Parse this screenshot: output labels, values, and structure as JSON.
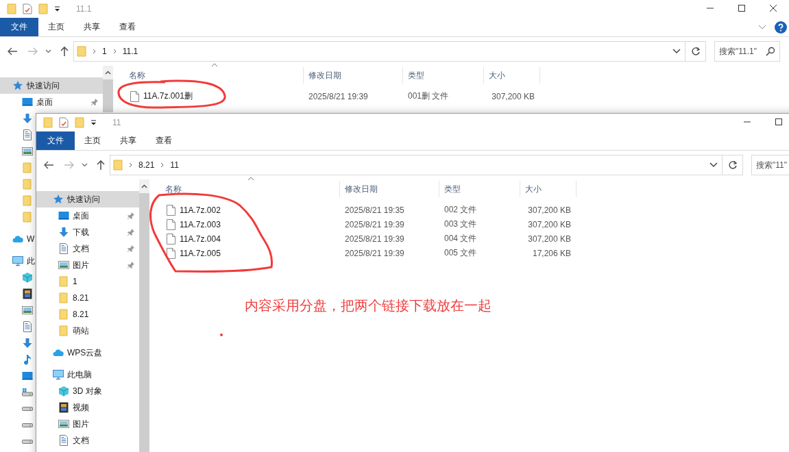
{
  "windows": [
    {
      "title": "11.1",
      "ribbon_tabs": [
        {
          "label": "文件",
          "selected": true
        },
        {
          "label": "主页",
          "selected": false
        },
        {
          "label": "共享",
          "selected": false
        },
        {
          "label": "查看",
          "selected": false
        }
      ],
      "path": [
        "1",
        "11.1"
      ],
      "search": {
        "placeholder": "搜索\"11.1\""
      },
      "columns": [
        "名称",
        "修改日期",
        "类型",
        "大小"
      ],
      "sidebar": [
        {
          "label": "快速访问",
          "kind": "star",
          "selected": true,
          "children": [
            {
              "label": "桌面",
              "kind": "desktop",
              "pinned": true
            },
            {
              "kind": "download",
              "pinned": false
            },
            {
              "kind": "document",
              "pinned": false
            },
            {
              "kind": "picture",
              "pinned": false
            },
            {
              "kind": "folder",
              "pinned": false
            },
            {
              "kind": "folder",
              "pinned": false
            },
            {
              "kind": "folder",
              "pinned": false
            },
            {
              "kind": "folder",
              "pinned": false
            }
          ]
        },
        {
          "label": "W",
          "kind": "cloud",
          "selected": false
        },
        {
          "label": "此",
          "kind": "pc",
          "selected": false,
          "children": [
            {
              "kind": "cube"
            },
            {
              "kind": "video"
            },
            {
              "kind": "picture"
            },
            {
              "kind": "document"
            },
            {
              "kind": "download"
            },
            {
              "kind": "music"
            },
            {
              "kind": "desktop"
            },
            {
              "kind": "drive-win"
            },
            {
              "kind": "drive"
            },
            {
              "kind": "drive"
            },
            {
              "kind": "drive"
            }
          ]
        }
      ],
      "files": [
        {
          "name": "11A.7z.001删",
          "date": "2025/8/21 19:39",
          "type": "001删 文件",
          "size": "307,200 KB"
        }
      ]
    },
    {
      "title": "11",
      "ribbon_tabs": [
        {
          "label": "文件",
          "selected": true
        },
        {
          "label": "主页",
          "selected": false
        },
        {
          "label": "共享",
          "selected": false
        },
        {
          "label": "查看",
          "selected": false
        }
      ],
      "path": [
        "8.21",
        "11"
      ],
      "search": {
        "placeholder": "搜索\"11\""
      },
      "columns": [
        "名称",
        "修改日期",
        "类型",
        "大小"
      ],
      "sidebar": [
        {
          "label": "快速访问",
          "kind": "star",
          "selected": true,
          "children": [
            {
              "label": "桌面",
              "kind": "desktop",
              "pinned": true
            },
            {
              "label": "下载",
              "kind": "download",
              "pinned": true
            },
            {
              "label": "文档",
              "kind": "document",
              "pinned": true
            },
            {
              "label": "图片",
              "kind": "picture",
              "pinned": true
            },
            {
              "label": "1",
              "kind": "folder",
              "pinned": false
            },
            {
              "label": "8.21",
              "kind": "folder",
              "pinned": false
            },
            {
              "label": "8.21",
              "kind": "folder",
              "pinned": false
            },
            {
              "label": "萌站",
              "kind": "folder",
              "pinned": false
            }
          ]
        },
        {
          "label": "WPS云盘",
          "kind": "cloud",
          "selected": false
        },
        {
          "label": "此电脑",
          "kind": "pc",
          "selected": false,
          "children": [
            {
              "label": "3D 对象",
              "kind": "cube"
            },
            {
              "label": "视频",
              "kind": "video"
            },
            {
              "label": "图片",
              "kind": "picture"
            },
            {
              "label": "文档",
              "kind": "document"
            }
          ]
        }
      ],
      "files": [
        {
          "name": "11A.7z.002",
          "date": "2025/8/21 19:35",
          "type": "002 文件",
          "size": "307,200 KB"
        },
        {
          "name": "11A.7z.003",
          "date": "2025/8/21 19:39",
          "type": "003 文件",
          "size": "307,200 KB"
        },
        {
          "name": "11A.7z.004",
          "date": "2025/8/21 19:39",
          "type": "004 文件",
          "size": "307,200 KB"
        },
        {
          "name": "11A.7z.005",
          "date": "2025/8/21 19:39",
          "type": "005 文件",
          "size": "17,206 KB"
        }
      ]
    }
  ],
  "annotation": {
    "note": "内容采用分盘，把两个链接下载放在一起"
  }
}
